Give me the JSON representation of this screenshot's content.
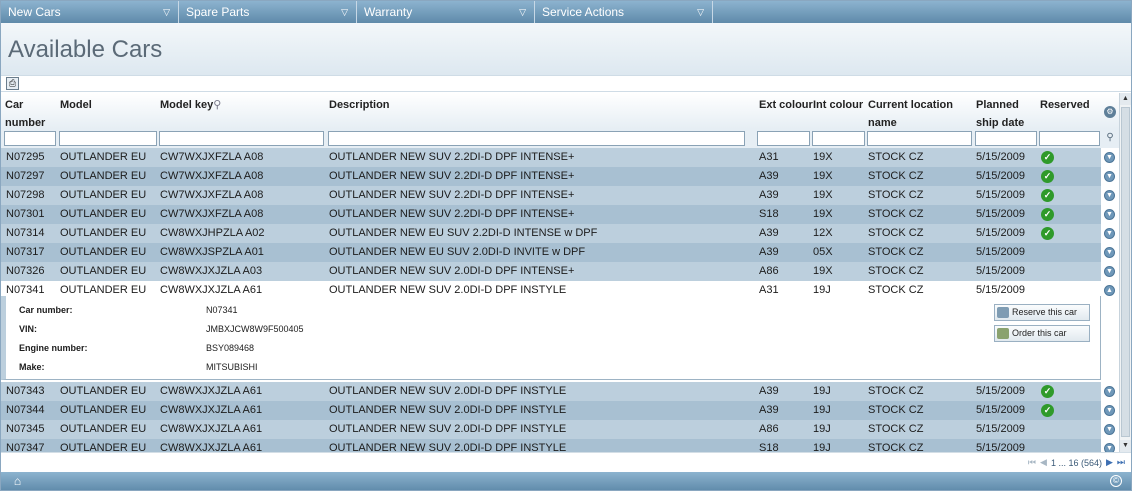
{
  "menu": [
    {
      "label": "New Cars"
    },
    {
      "label": "Spare Parts"
    },
    {
      "label": "Warranty"
    },
    {
      "label": "Service Actions"
    }
  ],
  "page_title": "Available Cars",
  "columns": {
    "car_number": "Car number",
    "model": "Model",
    "model_key": "Model key",
    "description": "Description",
    "ext_colour": "Ext colour",
    "int_colour": "Int colour",
    "current_location": "Current location name",
    "planned_ship_date": "Planned ship date",
    "reserved": "Reserved"
  },
  "rows": [
    {
      "car": "N07295",
      "model": "OUTLANDER EU",
      "key": "CW7WXJXFZLA A08",
      "desc": "OUTLANDER NEW SUV 2.2DI-D DPF INTENSE+",
      "ext": "A31",
      "int": "19X",
      "loc": "STOCK CZ",
      "date": "5/15/2009",
      "reserved": true
    },
    {
      "car": "N07297",
      "model": "OUTLANDER EU",
      "key": "CW7WXJXFZLA A08",
      "desc": "OUTLANDER NEW SUV 2.2DI-D DPF INTENSE+",
      "ext": "A39",
      "int": "19X",
      "loc": "STOCK CZ",
      "date": "5/15/2009",
      "reserved": true
    },
    {
      "car": "N07298",
      "model": "OUTLANDER EU",
      "key": "CW7WXJXFZLA A08",
      "desc": "OUTLANDER NEW SUV 2.2DI-D DPF INTENSE+",
      "ext": "A39",
      "int": "19X",
      "loc": "STOCK CZ",
      "date": "5/15/2009",
      "reserved": true
    },
    {
      "car": "N07301",
      "model": "OUTLANDER EU",
      "key": "CW7WXJXFZLA A08",
      "desc": "OUTLANDER NEW SUV 2.2DI-D DPF INTENSE+",
      "ext": "S18",
      "int": "19X",
      "loc": "STOCK CZ",
      "date": "5/15/2009",
      "reserved": true
    },
    {
      "car": "N07314",
      "model": "OUTLANDER EU",
      "key": "CW8WXJHPZLA A02",
      "desc": "OUTLANDER NEW EU SUV 2.2DI-D INTENSE w DPF",
      "ext": "A39",
      "int": "12X",
      "loc": "STOCK CZ",
      "date": "5/15/2009",
      "reserved": true
    },
    {
      "car": "N07317",
      "model": "OUTLANDER EU",
      "key": "CW8WXJSPZLA A01",
      "desc": "OUTLANDER NEW EU SUV 2.0DI-D INVITE w DPF",
      "ext": "A39",
      "int": "05X",
      "loc": "STOCK CZ",
      "date": "5/15/2009",
      "reserved": false
    },
    {
      "car": "N07326",
      "model": "OUTLANDER EU",
      "key": "CW8WXJXJZLA A03",
      "desc": "OUTLANDER NEW SUV 2.0DI-D DPF INTENSE+",
      "ext": "A86",
      "int": "19X",
      "loc": "STOCK CZ",
      "date": "5/15/2009",
      "reserved": false
    },
    {
      "car": "N07341",
      "model": "OUTLANDER EU",
      "key": "CW8WXJXJZLA A61",
      "desc": "OUTLANDER NEW SUV 2.0DI-D DPF INSTYLE",
      "ext": "A31",
      "int": "19J",
      "loc": "STOCK CZ",
      "date": "5/15/2009",
      "reserved": false
    },
    {
      "car": "N07343",
      "model": "OUTLANDER EU",
      "key": "CW8WXJXJZLA A61",
      "desc": "OUTLANDER NEW SUV 2.0DI-D DPF INSTYLE",
      "ext": "A39",
      "int": "19J",
      "loc": "STOCK CZ",
      "date": "5/15/2009",
      "reserved": true
    },
    {
      "car": "N07344",
      "model": "OUTLANDER EU",
      "key": "CW8WXJXJZLA A61",
      "desc": "OUTLANDER NEW SUV 2.0DI-D DPF INSTYLE",
      "ext": "A39",
      "int": "19J",
      "loc": "STOCK CZ",
      "date": "5/15/2009",
      "reserved": true
    },
    {
      "car": "N07345",
      "model": "OUTLANDER EU",
      "key": "CW8WXJXJZLA A61",
      "desc": "OUTLANDER NEW SUV 2.0DI-D DPF INSTYLE",
      "ext": "A86",
      "int": "19J",
      "loc": "STOCK CZ",
      "date": "5/15/2009",
      "reserved": false
    },
    {
      "car": "N07347",
      "model": "OUTLANDER EU",
      "key": "CW8WXJXJZLA A61",
      "desc": "OUTLANDER NEW SUV 2.0DI-D DPF INSTYLE",
      "ext": "S18",
      "int": "19J",
      "loc": "STOCK CZ",
      "date": "5/15/2009",
      "reserved": false
    }
  ],
  "detail": {
    "car_number_label": "Car number:",
    "car_number": "N07341",
    "vin_label": "VIN:",
    "vin": "JMBXJCW8W9F500405",
    "engine_label": "Engine number:",
    "engine": "BSY089468",
    "make_label": "Make:",
    "make": "MITSUBISHI",
    "reserve_button": "Reserve this car",
    "order_button": "Order this car"
  },
  "pager": {
    "text": "1 ... 16 (564)"
  },
  "icons": {
    "print": "print-icon",
    "search": "magnifier-icon",
    "settings": "gear-icon",
    "home": "home-icon",
    "copyright": "copyright-icon"
  },
  "colors": {
    "menu_bar": "#6f9abb",
    "row_light": "#bccfdd",
    "row_dark": "#a8c0d2",
    "reserved_check": "#2f9a2a"
  }
}
